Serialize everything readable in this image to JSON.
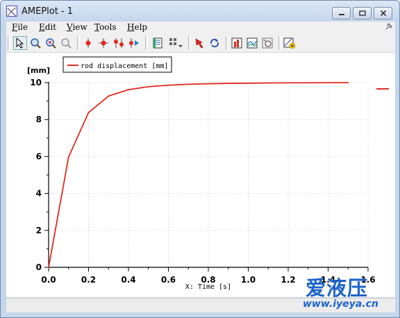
{
  "window": {
    "title": "AMEPlot - 1",
    "controls": {
      "minimize": "▭",
      "maximize": "▢",
      "close": "✕"
    }
  },
  "menu": {
    "items": [
      {
        "mnemonic": "F",
        "rest": "ile"
      },
      {
        "mnemonic": "E",
        "rest": "dit"
      },
      {
        "mnemonic": "V",
        "rest": "iew"
      },
      {
        "mnemonic": "T",
        "rest": "ools"
      },
      {
        "mnemonic": "H",
        "rest": "elp"
      }
    ],
    "pin_icon": "pin-icon"
  },
  "toolbar": {
    "buttons": [
      "select-pointer",
      "zoom-in",
      "zoom-fit",
      "zoom-out",
      "cursor-red",
      "cursor-cross",
      "cursor-pair",
      "cursor-play",
      "plot-properties",
      "grid-layout",
      "marker-pin",
      "refresh-link",
      "chart-red",
      "chart-wave",
      "chart-tools",
      "export-add"
    ]
  },
  "chart_data": {
    "type": "line",
    "title": "",
    "xlabel": "X: Time [s]",
    "ylabel": "[mm]",
    "xlim": [
      0,
      1.6
    ],
    "ylim": [
      0,
      10
    ],
    "xticks": [
      "0.0",
      "0.2",
      "0.4",
      "0.6",
      "0.8",
      "1.0",
      "1.2",
      "1.4",
      "1.6"
    ],
    "yticks": [
      "0",
      "2",
      "4",
      "6",
      "8",
      "10"
    ],
    "grid": true,
    "legend_position": "top-left",
    "series": [
      {
        "name": "rod displacement [mm]",
        "color": "#e0291f",
        "x": [
          0.0,
          0.1,
          0.2,
          0.3,
          0.4,
          0.5,
          0.6,
          0.7,
          0.8,
          0.9,
          1.0,
          1.1,
          1.2,
          1.3,
          1.4,
          1.5
        ],
        "y": [
          0.0,
          5.97,
          8.38,
          9.27,
          9.62,
          9.78,
          9.86,
          9.91,
          9.94,
          9.96,
          9.97,
          9.98,
          9.99,
          9.99,
          10.0,
          10.0
        ]
      }
    ]
  },
  "watermark": {
    "chinese": "爱液压",
    "url": "www.iyeya.cn"
  }
}
